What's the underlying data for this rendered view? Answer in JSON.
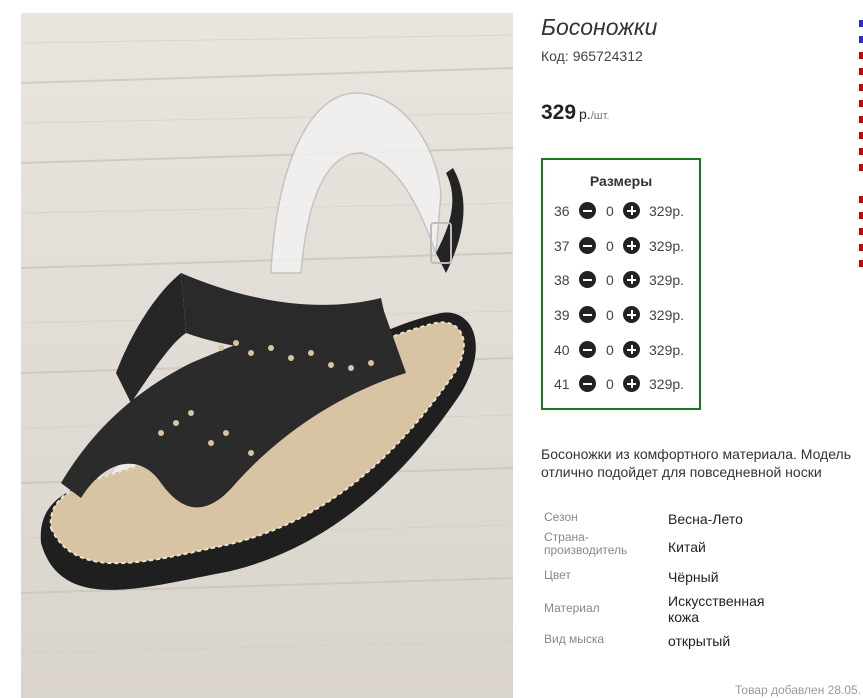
{
  "product": {
    "title": "Босоножки",
    "code_label": "Код:",
    "code_value": "965724312",
    "price_value": "329",
    "price_currency": "р.",
    "price_unit": "/шт."
  },
  "sizes": {
    "heading": "Размеры",
    "rows": [
      {
        "size": "36",
        "qty": "0",
        "price": "329р."
      },
      {
        "size": "37",
        "qty": "0",
        "price": "329р."
      },
      {
        "size": "38",
        "qty": "0",
        "price": "329р."
      },
      {
        "size": "39",
        "qty": "0",
        "price": "329р."
      },
      {
        "size": "40",
        "qty": "0",
        "price": "329р."
      },
      {
        "size": "41",
        "qty": "0",
        "price": "329р."
      }
    ]
  },
  "description": "Босоножки из комфортного материала. Модель отлично подойдет для повседневной носки",
  "attributes": [
    {
      "key": "Сезон",
      "value": "Весна-Лето"
    },
    {
      "key": "Страна-производитель",
      "value": "Китай"
    },
    {
      "key": "Цвет",
      "value": "Чёрный"
    },
    {
      "key": "Материал",
      "value": "Искусственная кожа"
    },
    {
      "key": "Вид мыска",
      "value": "открытый"
    }
  ],
  "footer": {
    "added_text": "Товар добавлен 28.05."
  },
  "colors": {
    "sizes_border": "#1a7a1a",
    "button": "#222222",
    "edge_red": "#cc0000",
    "edge_blue": "#2a2ad0"
  }
}
